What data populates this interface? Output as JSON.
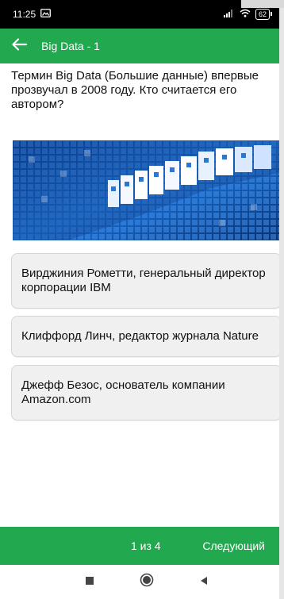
{
  "status_bar": {
    "time": "11:25",
    "battery": "62"
  },
  "app_bar": {
    "title": "Big Data - 1"
  },
  "question": {
    "text": "Термин Big Data (Большие данные) впервые прозвучал в 2008 году. Кто считается его автором?"
  },
  "options": [
    {
      "label": "Вирджиния Рометти, генеральный директор корпорации IBM"
    },
    {
      "label": "Клиффорд Линч, редактор журнала Nature"
    },
    {
      "label": "Джефф Безос, основатель компании Amazon.com"
    }
  ],
  "footer": {
    "counter": "1 из 4",
    "next_label": "Следующий"
  },
  "colors": {
    "accent": "#22a94f",
    "option_bg": "#f0f0f0",
    "image_blue": "#1a6fd1"
  }
}
